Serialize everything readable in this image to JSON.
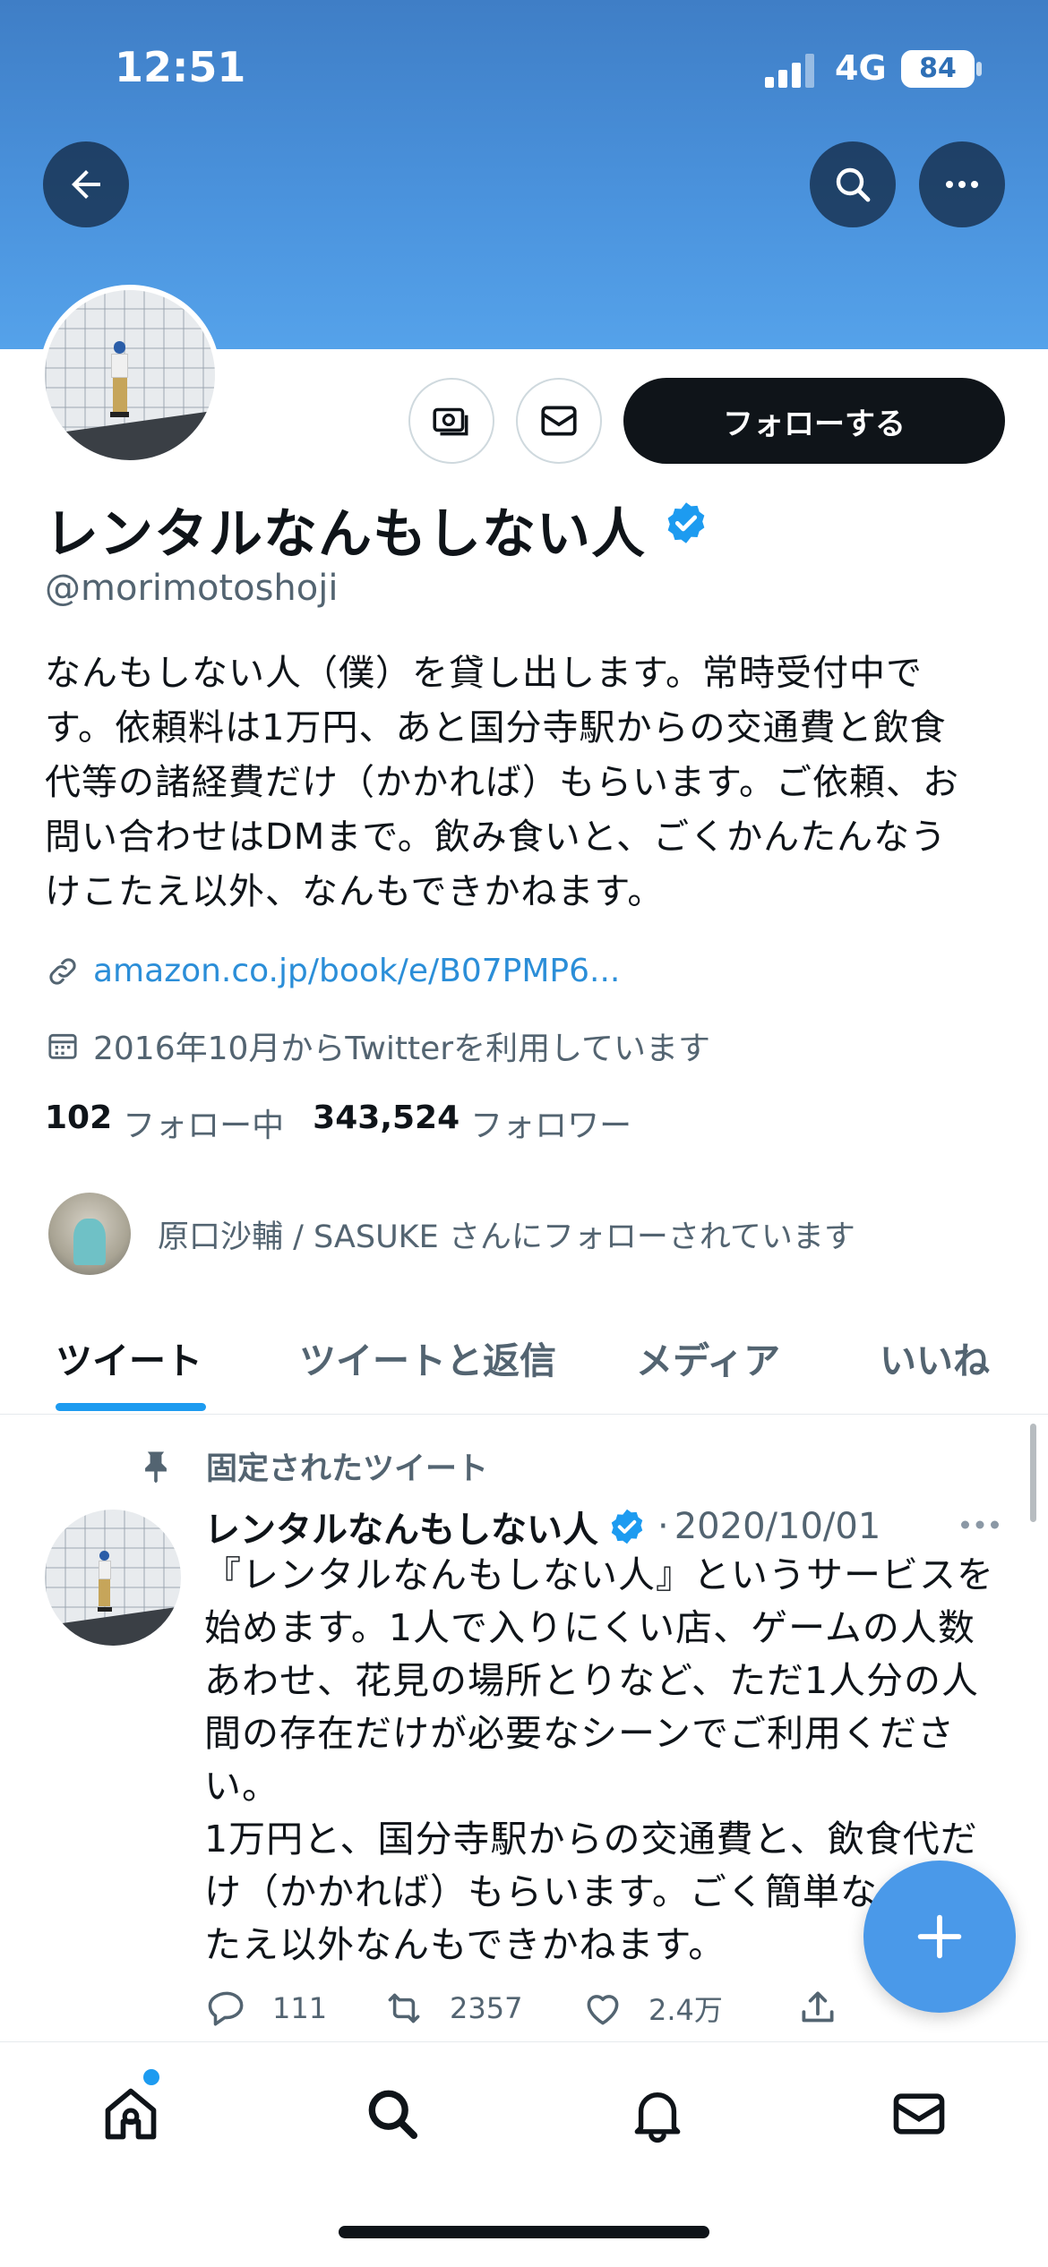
{
  "status_bar": {
    "time": "12:51",
    "network": "4G",
    "battery": "84"
  },
  "profile": {
    "name": "レンタルなんもしない人",
    "handle": "@morimotoshoji",
    "follow_label": "フォローする",
    "bio_lines": [
      "なんもしない人（僕）を貸し出します。常時受付中で",
      "す。依頼料は1万円、あと国分寺駅からの交通費と飲食",
      "代等の諸経費だけ（かかれば）もらいます。ご依頼、お",
      "問い合わせはDMまで。飲み食いと、ごくかんたんなう",
      "けこたえ以外、なんもできかねます。"
    ],
    "link": "amazon.co.jp/book/e/B07PMP6...",
    "joined": "2016年10月からTwitterを利用しています",
    "following_count": "102",
    "following_label": "フォロー中",
    "followers_count": "343,524",
    "followers_label": "フォロワー",
    "followed_by": "原口沙輔 / SASUKE さんにフォローされています"
  },
  "tabs": [
    "ツイート",
    "ツイートと返信",
    "メディア",
    "いいね"
  ],
  "pinned_tweet": {
    "pinned_label": "固定されたツイート",
    "author": "レンタルなんもしない人",
    "date": "2020/10/01",
    "separator": "·",
    "text_lines": [
      "『レンタルなんもしない人』というサービスを",
      "始めます。1人で入りにくい店、ゲームの人数",
      "あわせ、花見の場所とりなど、ただ1人分の人",
      "間の存在だけが必要なシーンでご利用くださ",
      "い。",
      "1万円と、国分寺駅からの交通費と、飲食代だ",
      "け（かかれば）もらいます。ごく簡単な",
      "たえ以外なんもできかねます。"
    ],
    "replies": "111",
    "retweets": "2357",
    "likes": "2.4万"
  },
  "icons": {
    "back": "arrow-left-icon",
    "search": "search-icon",
    "more": "more-icon",
    "tip": "money-icon",
    "message": "envelope-icon",
    "verified": "verified-badge-icon",
    "link": "link-icon",
    "calendar": "calendar-icon",
    "pin": "pin-icon",
    "compose": "plus-icon",
    "home": "home-icon",
    "explore": "search-icon",
    "notifications": "bell-icon",
    "messages": "envelope-icon"
  },
  "colors": {
    "banner": "#4a92dc",
    "accent": "#1d9bf0",
    "verified": "#1d9bf0",
    "fab": "#4a99e9",
    "follow_button": "#0f1419"
  }
}
